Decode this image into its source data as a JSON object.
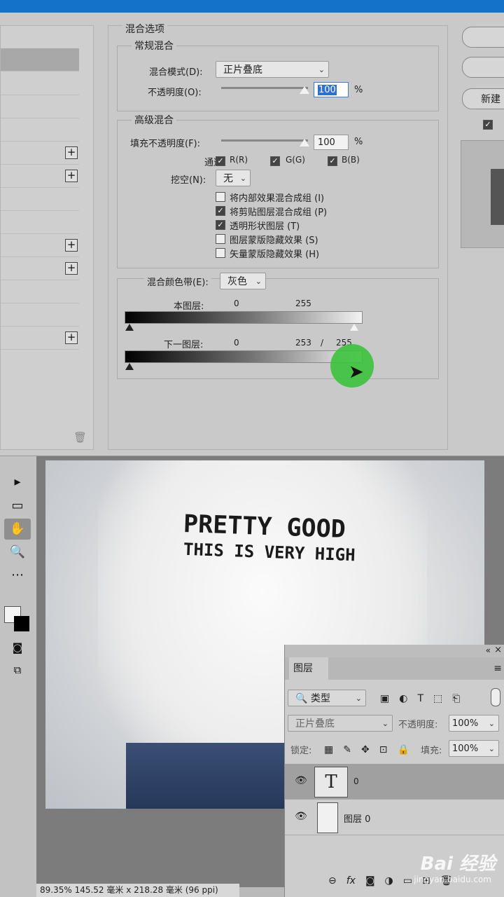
{
  "dialog": {
    "section_title": "混合选项",
    "general": {
      "title": "常规混合",
      "blend_mode_label": "混合模式(D):",
      "blend_mode_value": "正片叠底",
      "opacity_label": "不透明度(O):",
      "opacity_value": "100",
      "percent": "%"
    },
    "advanced": {
      "title": "高级混合",
      "fill_label": "填充不透明度(F):",
      "fill_value": "100",
      "percent": "%",
      "channels_label": "通道:",
      "channel_r": "R(R)",
      "channel_g": "G(G)",
      "channel_b": "B(B)",
      "knockout_label": "挖空(N):",
      "knockout_value": "无",
      "options": [
        {
          "label": "将内部效果混合成组 (I)",
          "checked": false
        },
        {
          "label": "将剪贴图层混合成组 (P)",
          "checked": true
        },
        {
          "label": "透明形状图层 (T)",
          "checked": true
        },
        {
          "label": "图层蒙版隐藏效果 (S)",
          "checked": false
        },
        {
          "label": "矢量蒙版隐藏效果 (H)",
          "checked": false
        }
      ]
    },
    "blend_if": {
      "label": "混合颜色带(E):",
      "value": "灰色",
      "this_layer_label": "本图层:",
      "this_layer_low": "0",
      "this_layer_high": "255",
      "underlying_label": "下一图层:",
      "underlying_low": "0",
      "underlying_high_split_a": "253",
      "slash": "/",
      "underlying_high_split_b": "255"
    },
    "right_buttons": {
      "new_style": "新建"
    }
  },
  "canvas": {
    "shirt_line1": "PRETTY GOOD",
    "shirt_line2": "THIS IS VERY HIGH"
  },
  "status_bar": "89.35%  145.52 毫米 x 218.28 毫米 (96 ppi)",
  "layers_panel": {
    "tab": "图层",
    "filter_label": "类型",
    "blend_mode": "正片叠底",
    "opacity_label": "不透明度:",
    "opacity_value": "100%",
    "lock_label": "锁定:",
    "fill_label": "填充:",
    "fill_value": "100%",
    "layers": [
      {
        "name": "0",
        "type": "text",
        "thumb": "T",
        "selected": true
      },
      {
        "name": "图层 0",
        "type": "image",
        "selected": false
      }
    ],
    "footer_fx": "fx"
  },
  "watermark": {
    "brand": "Bai 经验",
    "url": "jingyan.baidu.com"
  }
}
